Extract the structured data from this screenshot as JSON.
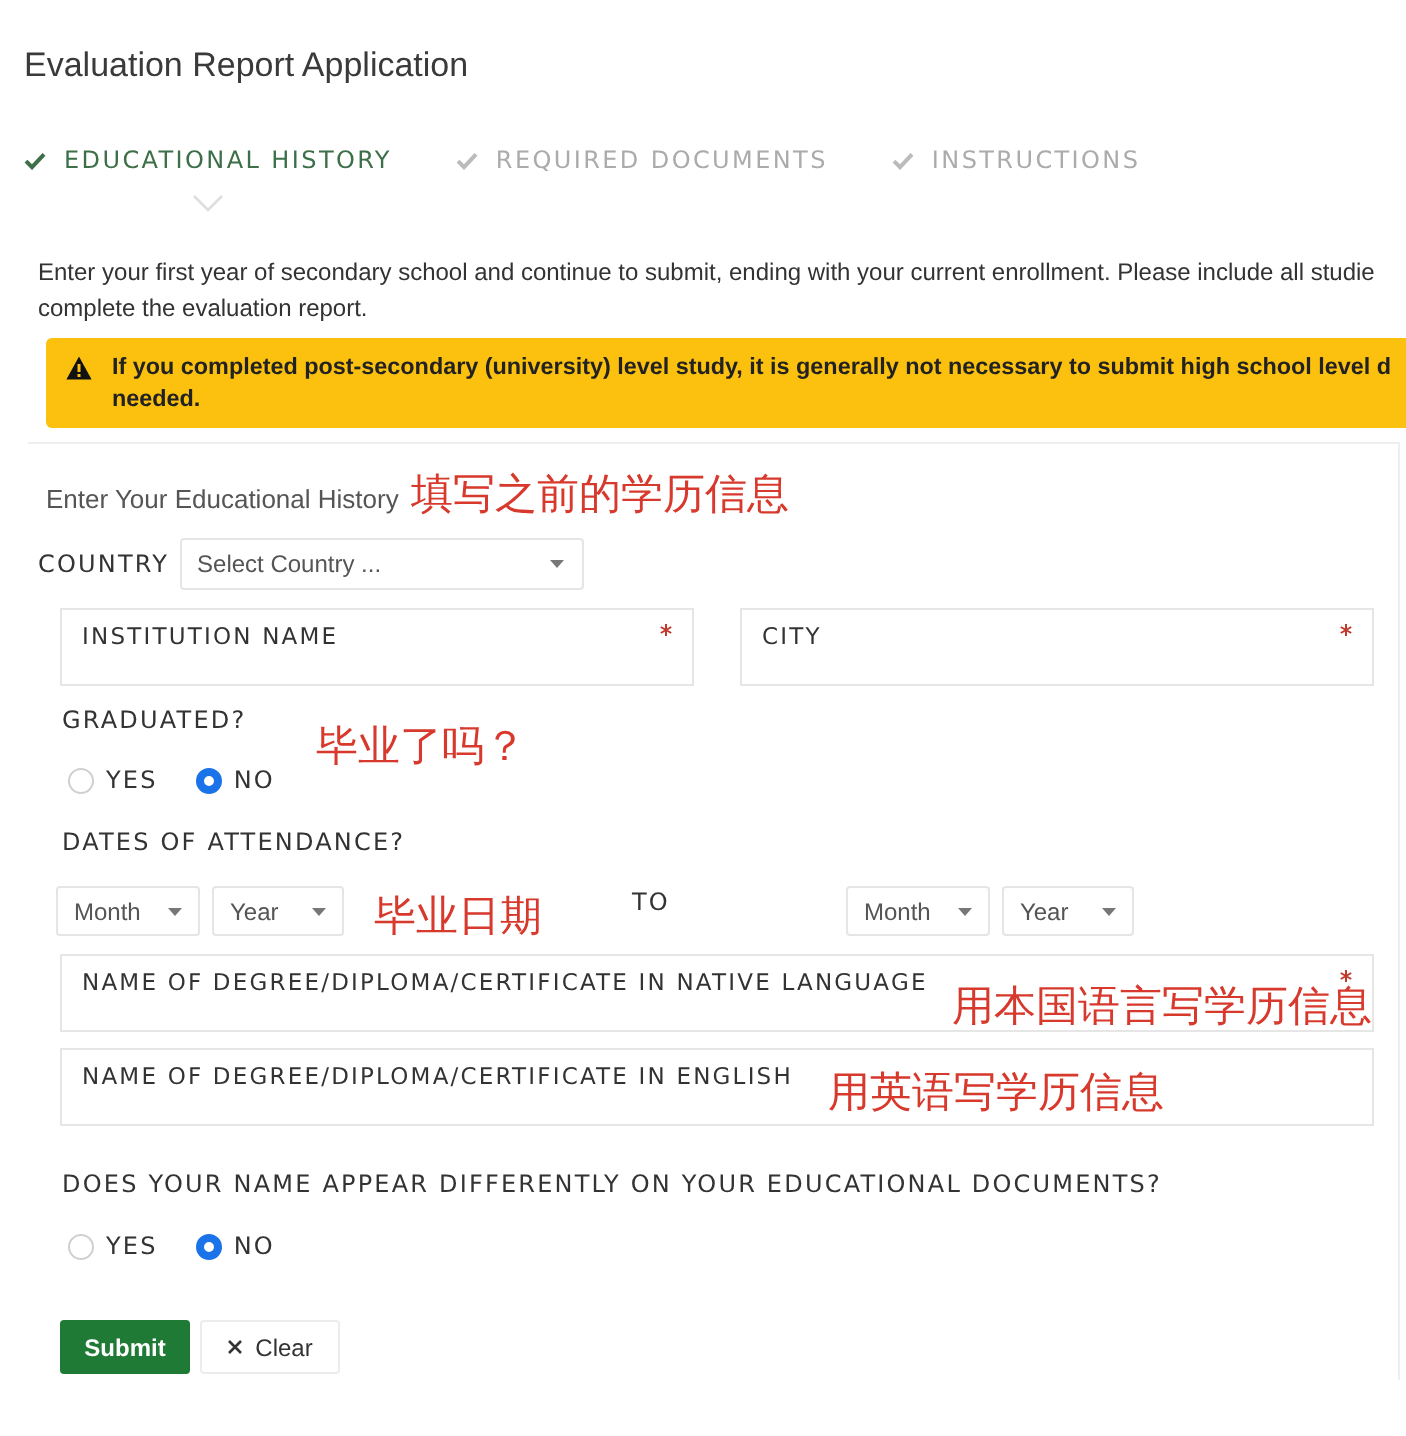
{
  "title": "Evaluation Report Application",
  "steps": [
    {
      "label": "EDUCATIONAL HISTORY",
      "selected": true
    },
    {
      "label": "REQUIRED DOCUMENTS",
      "selected": false
    },
    {
      "label": "INSTRUCTIONS",
      "selected": false
    }
  ],
  "intro": [
    "Enter your first year of secondary school and continue to submit, ending with your current enrollment. Please include all studie",
    "complete the evaluation report."
  ],
  "alert": {
    "lines": [
      "If you completed post-secondary (university) level study, it is generally not necessary to submit high school level d",
      "needed."
    ]
  },
  "form": {
    "heading": "Enter Your Educational History",
    "heading_note": "填写之前的学历信息",
    "country": {
      "label": "COUNTRY",
      "placeholder": "Select Country ..."
    },
    "fields": [
      {
        "label": "INSTITUTION NAME",
        "required": true
      },
      {
        "label": "CITY",
        "required": true
      }
    ],
    "graduated": {
      "question": "GRADUATED?",
      "note": "毕业了吗？",
      "options": [
        {
          "label": "YES",
          "selected": false
        },
        {
          "label": "NO",
          "selected": true
        }
      ]
    },
    "attendance": {
      "question": "DATES OF ATTENDANCE?",
      "from": [
        {
          "placeholder": "Month"
        },
        {
          "placeholder": "Year"
        }
      ],
      "note": "毕业日期",
      "separator": "TO",
      "to": [
        {
          "placeholder": "Month"
        },
        {
          "placeholder": "Year"
        }
      ]
    },
    "degree_fields": [
      {
        "label": "NAME OF DEGREE/DIPLOMA/CERTIFICATE IN NATIVE LANGUAGE",
        "required": true,
        "note": "用本国语言写学历信息"
      },
      {
        "label": "NAME OF DEGREE/DIPLOMA/CERTIFICATE IN ENGLISH",
        "required": false,
        "note": "用英语写学历信息"
      }
    ],
    "name_question": {
      "question": "DOES YOUR NAME APPEAR DIFFERENTLY ON YOUR EDUCATIONAL DOCUMENTS?",
      "options": [
        {
          "label": "YES",
          "selected": false
        },
        {
          "label": "NO",
          "selected": true
        }
      ]
    },
    "buttons": [
      {
        "kind": "primary",
        "label": "Submit"
      },
      {
        "kind": "clear",
        "label": "Clear"
      }
    ]
  }
}
